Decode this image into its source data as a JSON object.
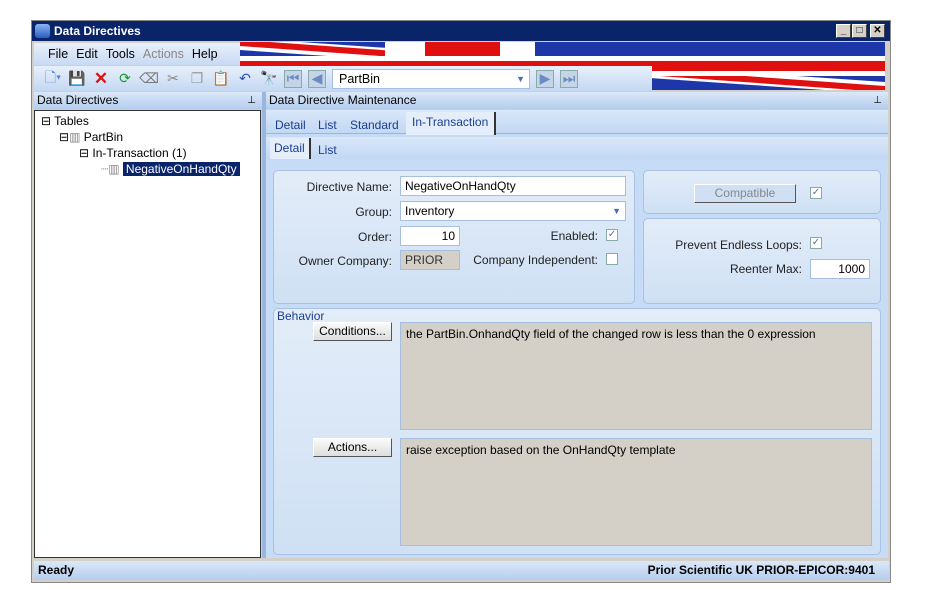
{
  "window": {
    "title": "Data Directives",
    "minimize": "_",
    "maximize": "□",
    "close": "✕"
  },
  "menu": [
    "File",
    "Edit",
    "Tools",
    "Actions",
    "Help"
  ],
  "toolbar": {
    "record": "PartBin"
  },
  "left_panel": {
    "title": "Data Directives",
    "pin": "📌"
  },
  "tree": {
    "root": "Tables",
    "table": "PartBin",
    "type": "In-Transaction (1)",
    "directive": "NegativeOnHandQty"
  },
  "right_panel": {
    "title": "Data Directive Maintenance"
  },
  "tabs": [
    "Detail",
    "List",
    "Standard",
    "In-Transaction"
  ],
  "subtabs": [
    "Detail",
    "List"
  ],
  "form": {
    "directive_name_label": "Directive Name:",
    "directive_name": "NegativeOnHandQty",
    "group_label": "Group:",
    "group": "Inventory",
    "order_label": "Order:",
    "order": "10",
    "enabled_label": "Enabled:",
    "enabled": true,
    "owner_label": "Owner Company:",
    "owner": "PRIOR",
    "company_independent_label": "Company Independent:",
    "company_independent": false,
    "compatible_label": "Compatible",
    "compatible": true,
    "prevent_loops_label": "Prevent Endless Loops:",
    "prevent_loops": true,
    "reenter_label": "Reenter Max:",
    "reenter": "1000"
  },
  "behavior": {
    "title": "Behavior",
    "conditions_button": "Conditions...",
    "conditions_text": "the PartBin.OnhandQty field of the changed row is less than the 0 expression",
    "actions_button": "Actions...",
    "actions_text": "raise exception based on the OnHandQty template"
  },
  "status": {
    "left": "Ready",
    "right": "Prior Scientific UK  PRIOR-EPICOR:9401"
  }
}
